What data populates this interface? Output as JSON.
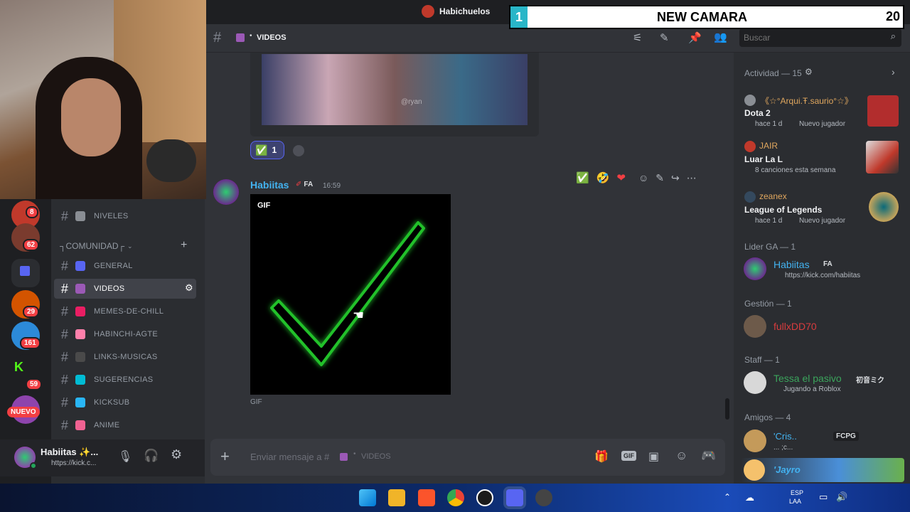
{
  "window": {
    "server_title": "Habichuelos"
  },
  "overlay": {
    "left_num": "1",
    "title": "NEW CAMARA",
    "right_num": "20"
  },
  "header": {
    "channel_name": "VIDEOS",
    "search_placeholder": "Buscar"
  },
  "rail": {
    "badges": [
      "8",
      "62",
      "29",
      "161",
      "59"
    ],
    "new_label": "NUEVO"
  },
  "sidebar": {
    "channels_top": [
      {
        "label": "NIVELES"
      }
    ],
    "category": "┐COMUNIDAD┌",
    "channels": [
      {
        "label": "GENERAL",
        "icon_color": "#5865f2"
      },
      {
        "label": "VIDEOS",
        "icon_color": "#9b59b6",
        "active": true
      },
      {
        "label": "MEMES-DE-CHILL",
        "icon_color": "#e91e63"
      },
      {
        "label": "HABINCHI-AGTE",
        "icon_color": "#ff80ab"
      },
      {
        "label": "LINKS-MUSICAS",
        "icon_color": "#4a4a4a"
      },
      {
        "label": "SUGERENCIAS",
        "icon_color": "#00bcd4"
      },
      {
        "label": "KICKSUB",
        "icon_color": "#29b6f6"
      },
      {
        "label": "ANIME",
        "icon_color": "#f06292"
      }
    ]
  },
  "user": {
    "name": "Habiitas ✨...",
    "status": "https://kick.c..."
  },
  "chat": {
    "reaction": {
      "emoji": "✅",
      "count": "1"
    },
    "message": {
      "author": "Habiitas",
      "tag": "FA",
      "time": "16:59",
      "gif_badge": "GIF",
      "caption": "GIF"
    },
    "hover_reactions": [
      "✅",
      "🤣",
      "❤"
    ],
    "composer_placeholder": "Enviar mensaje a #",
    "composer_channel": "VIDEOS",
    "video_watermark": "@ryan"
  },
  "members": {
    "activity_header": "Actividad — 15",
    "activities": [
      {
        "user": "《☆°Arqui.Ŧ.saurio°☆》",
        "title": "Dota 2",
        "meta1": "hace 1 d",
        "meta2": "Nuevo jugador",
        "user_color": "#e0a75e"
      },
      {
        "user": "JAIR",
        "title": "Luar La L",
        "meta1": "8 canciones esta semana",
        "meta2": "",
        "user_color": "#e0a75e"
      },
      {
        "user": "zeanex",
        "title": "League of Legends",
        "meta1": "hace 1 d",
        "meta2": "Nuevo jugador",
        "user_color": "#e0a75e"
      }
    ],
    "groups": [
      {
        "header": "Lider GA — 1",
        "name": "Habiitas",
        "tag": "FA",
        "sub": "https://kick.com/habiitas",
        "color": "#43b2f0"
      },
      {
        "header": "Gestión — 1",
        "name": "fullxDD70",
        "tag": "",
        "sub": "",
        "color": "#d83c3e"
      },
      {
        "header": "Staff — 1",
        "name": "Tessa el pasivo",
        "tag": "初音ミク",
        "sub": "Jugando a Roblox",
        "color": "#3ba55c"
      },
      {
        "header": "Amigos — 4",
        "name": "'Cris..",
        "tag": "FCPG",
        "sub": "... ;c...",
        "color": "#43b2f0"
      }
    ],
    "last_member": "'Jayro"
  },
  "taskbar": {
    "lang": "ESP",
    "region": "LAA"
  }
}
